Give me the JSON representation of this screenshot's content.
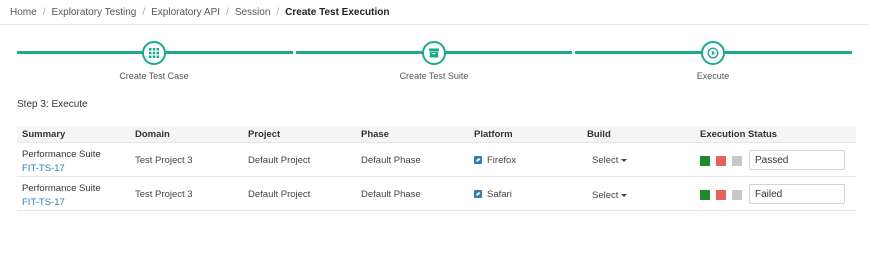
{
  "breadcrumb": {
    "items": [
      "Home",
      "Exploratory Testing",
      "Exploratory API",
      "Session",
      "Create Test Execution"
    ],
    "separator": "/"
  },
  "stepper": {
    "steps": [
      {
        "label": "Create Test Case",
        "icon": "grid-icon"
      },
      {
        "label": "Create Test Suite",
        "icon": "archive-box-icon"
      },
      {
        "label": "Execute",
        "icon": "play-circle-icon"
      }
    ],
    "accent_color": "#1aaa8c"
  },
  "section": {
    "title": "Step 3: Execute"
  },
  "table": {
    "headers": [
      "Summary",
      "Domain",
      "Project",
      "Phase",
      "Platform",
      "Build",
      "Execution Status"
    ],
    "rows": [
      {
        "summary_name": "Performance Suite",
        "summary_link": "FIT-TS-17",
        "domain": "Test Project 3",
        "project": "Default Project",
        "phase": "Default Phase",
        "platform": "Firefox",
        "build": "Select",
        "status_value": "Passed"
      },
      {
        "summary_name": "Performance Suite",
        "summary_link": "FIT-TS-17",
        "domain": "Test Project 3",
        "project": "Default Project",
        "phase": "Default Phase",
        "platform": "Safari",
        "build": "Select",
        "status_value": "Failed"
      }
    ],
    "status_colors": {
      "pass": "#1e8a2e",
      "fail": "#e8625d",
      "none": "#c8c8c8"
    },
    "link_color": "#2e7db8"
  }
}
